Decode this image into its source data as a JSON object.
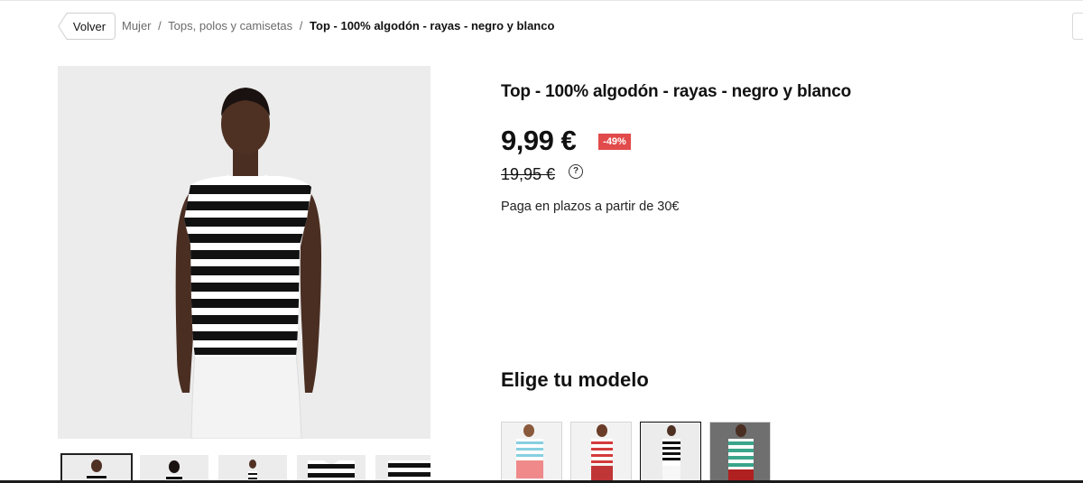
{
  "nav": {
    "back_label": "Volver",
    "breadcrumb": [
      "Mujer",
      "Tops, polos y camisetas"
    ],
    "breadcrumb_current": "Top - 100% algodón - rayas - negro y blanco",
    "separator": "/"
  },
  "product": {
    "title": "Top - 100% algodón - rayas - negro y blanco",
    "price": "9,99 €",
    "discount": "-49%",
    "old_price": "19,95 €",
    "installments_text": "Paga en plazos a partir de 30€",
    "info_icon": "info-icon"
  },
  "gallery": {
    "thumbnails": [
      {
        "view": "front",
        "active": true
      },
      {
        "view": "back",
        "active": false
      },
      {
        "view": "full",
        "active": false
      },
      {
        "view": "detail-flat",
        "active": false
      },
      {
        "view": "detail-fabric",
        "active": false
      }
    ]
  },
  "models": {
    "heading": "Elige tu modelo",
    "options": [
      {
        "color": "light-blue-white-stripes",
        "selected": false
      },
      {
        "color": "red-white-stripes",
        "selected": false
      },
      {
        "color": "black-white-stripes",
        "selected": true
      },
      {
        "color": "green-white-stripes",
        "selected": false
      }
    ]
  },
  "colors": {
    "discount_badge": "#e24b4b",
    "text": "#111111",
    "muted": "#6b6b6b",
    "image_bg": "#ececec"
  }
}
